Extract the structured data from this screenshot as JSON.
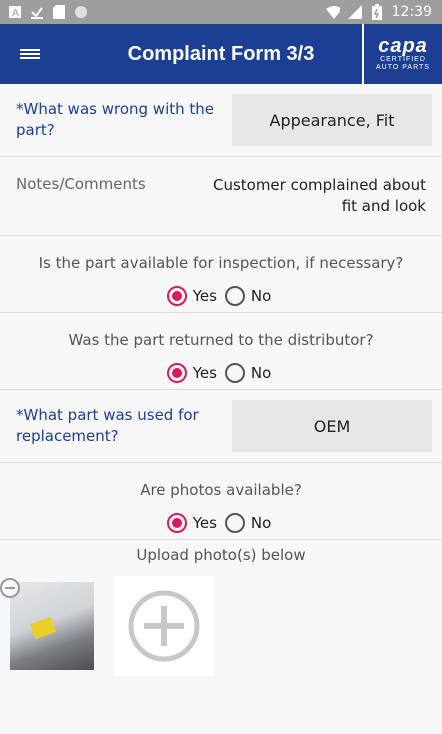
{
  "status_bar": {
    "time": "12:39",
    "icons_left": [
      "app-a-icon",
      "download-icon",
      "sd-card-icon",
      "circle-icon"
    ],
    "icons_right": [
      "wifi-icon",
      "signal-icon",
      "battery-icon"
    ]
  },
  "header": {
    "title": "Complaint Form 3/3",
    "menu_icon": "hamburger-icon",
    "logo_text": "capa",
    "logo_sub1": "CERTIFIED",
    "logo_sub2": "AUTO PARTS",
    "bg": "#1c3f94"
  },
  "q_wrong": {
    "label": "*What was wrong with the part?",
    "value": "Appearance, Fit"
  },
  "notes": {
    "label": "Notes/Comments",
    "value": "Customer complained about fit and look"
  },
  "q_inspection": {
    "question": "Is the part available for inspection, if necessary?",
    "yes": "Yes",
    "no": "No",
    "selected": "Yes"
  },
  "q_returned": {
    "question": "Was the part returned to the distributor?",
    "yes": "Yes",
    "no": "No",
    "selected": "Yes"
  },
  "q_replacement": {
    "label": "*What part was used for replacement?",
    "value": "OEM"
  },
  "q_photos": {
    "question": "Are photos available?",
    "yes": "Yes",
    "no": "No",
    "selected": "Yes"
  },
  "upload": {
    "title": "Upload photo(s) below",
    "add_icon": "add-circle-icon",
    "remove_icon": "remove-circle-icon"
  },
  "accent": "#d81b60"
}
